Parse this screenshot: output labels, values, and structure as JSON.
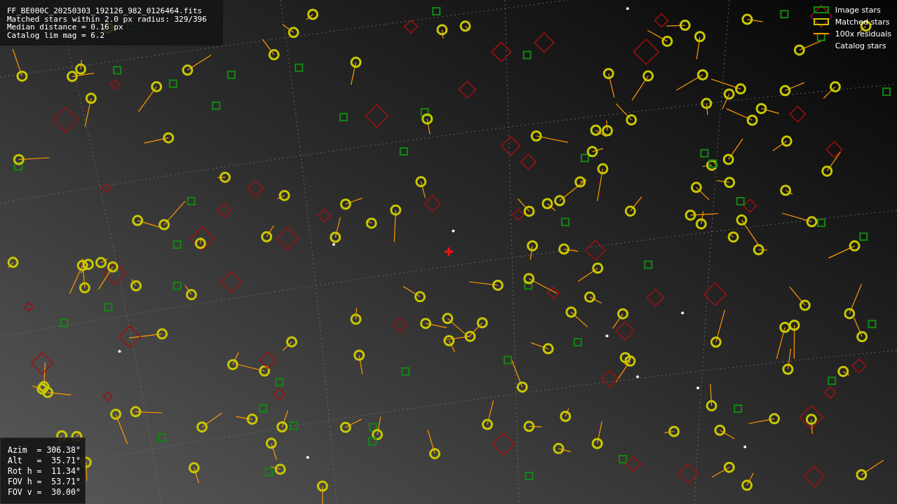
{
  "file_info": {
    "lines": [
      "FF_BE000C_20250303_192126_982_0126464.fits",
      "Matched stars within 2.0 px radius: 329/396",
      "Median distance = 0.16 px",
      "Catalog lim mag = 6.2"
    ]
  },
  "legend": [
    {
      "label": "Image stars",
      "kind": "box",
      "color": "#118811"
    },
    {
      "label": "Matched stars",
      "kind": "box",
      "color": "#c8c800"
    },
    {
      "label": "100x residuals",
      "kind": "line",
      "color": "#ff9900"
    },
    {
      "label": "Catalog stars",
      "kind": "none"
    }
  ],
  "pointing": {
    "lines": [
      "Azim  = 306.38°",
      "Alt   =  35.71°",
      "Rot h =  11.34°",
      "FOV h =  53.71°",
      "FOV v =  30.00°"
    ]
  }
}
